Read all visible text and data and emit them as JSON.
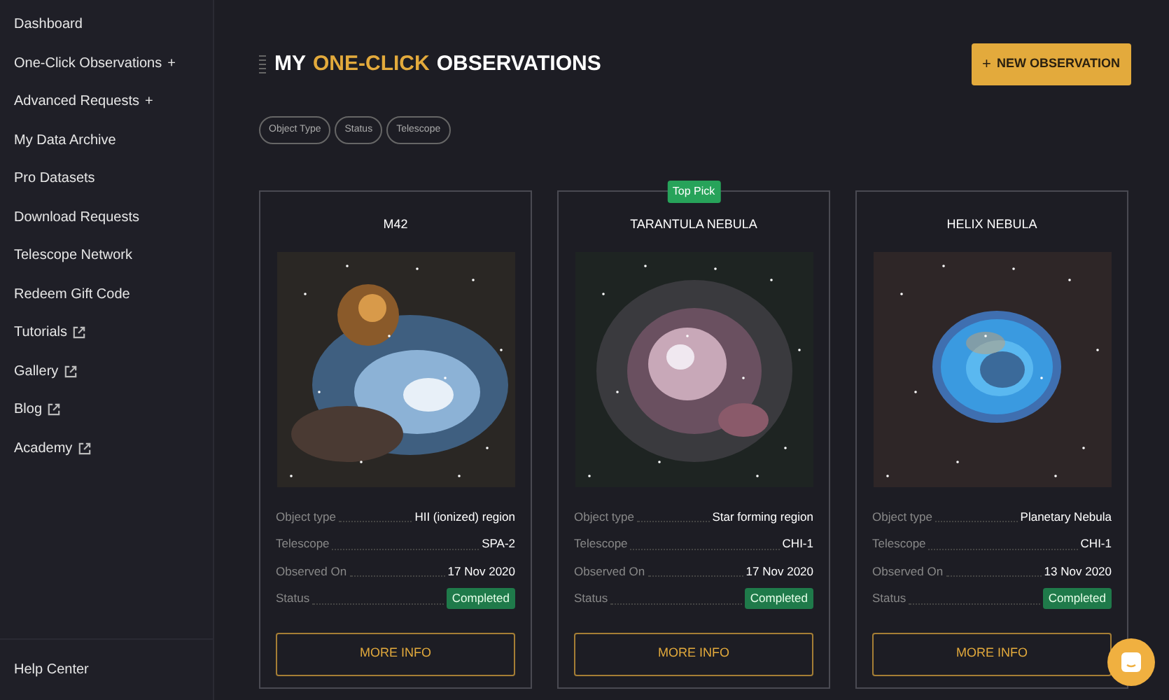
{
  "sidebar": {
    "items": [
      {
        "label": "Dashboard",
        "kind": "plain"
      },
      {
        "label": "One-Click Observations",
        "kind": "expand",
        "marker": "+"
      },
      {
        "label": "Advanced Requests",
        "kind": "expand",
        "marker": "+"
      },
      {
        "label": "My Data Archive",
        "kind": "plain"
      },
      {
        "label": "Pro Datasets",
        "kind": "plain"
      },
      {
        "label": "Download Requests",
        "kind": "plain"
      },
      {
        "label": "Telescope Network",
        "kind": "plain"
      },
      {
        "label": "Redeem Gift Code",
        "kind": "plain"
      },
      {
        "label": "Tutorials",
        "kind": "external"
      },
      {
        "label": "Gallery",
        "kind": "external"
      },
      {
        "label": "Blog",
        "kind": "external"
      },
      {
        "label": "Academy",
        "kind": "external"
      }
    ],
    "footer": "Help Center"
  },
  "header": {
    "title": [
      {
        "text": "MY",
        "highlight": false
      },
      {
        "text": "ONE-CLICK",
        "highlight": true
      },
      {
        "text": "OBSERVATIONS",
        "highlight": false
      }
    ],
    "button": {
      "icon": "+",
      "label": "NEW OBSERVATION"
    }
  },
  "filters": [
    "Object Type",
    "Status",
    "Telescope"
  ],
  "cards": [
    {
      "name": "M42",
      "fields": [
        {
          "label": "Object type",
          "value": "HII (ionized) region"
        },
        {
          "label": "Telescope",
          "value": "SPA-2"
        },
        {
          "label": "Observed On",
          "value": "17 Nov 2020"
        },
        {
          "label": "Status",
          "value": "Completed",
          "kind": "status"
        }
      ],
      "button": "MORE INFO"
    },
    {
      "name": "TARANTULA NEBULA",
      "badge": "Top Pick",
      "fields": [
        {
          "label": "Object type",
          "value": "Star forming region"
        },
        {
          "label": "Telescope",
          "value": "CHI-1"
        },
        {
          "label": "Observed On",
          "value": "17 Nov 2020"
        },
        {
          "label": "Status",
          "value": "Completed",
          "kind": "status"
        }
      ],
      "button": "MORE INFO"
    },
    {
      "name": "HELIX NEBULA",
      "fields": [
        {
          "label": "Object type",
          "value": "Planetary Nebula"
        },
        {
          "label": "Telescope",
          "value": "CHI-1"
        },
        {
          "label": "Observed On",
          "value": "13 Nov 2020"
        },
        {
          "label": "Status",
          "value": "Completed",
          "kind": "status"
        }
      ],
      "button": "MORE INFO"
    }
  ]
}
